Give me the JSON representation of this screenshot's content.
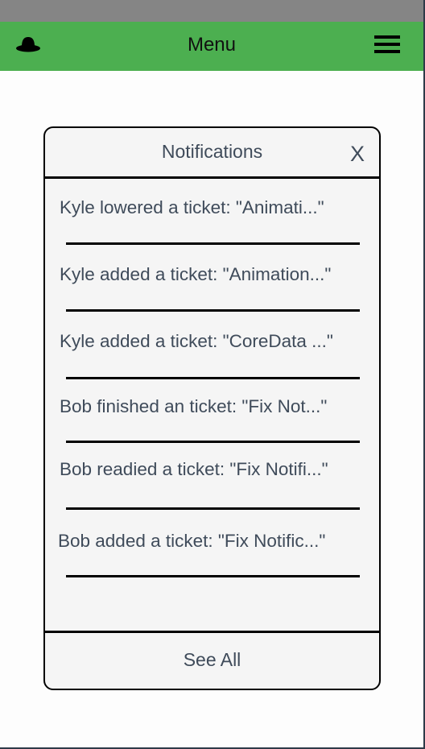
{
  "navbar": {
    "title": "Menu",
    "left_icon": "hat-icon",
    "right_icon": "hamburger-menu-icon",
    "color": "#4caf50"
  },
  "notifications": {
    "title": "Notifications",
    "close_label": "X",
    "items": [
      {
        "text": "Kyle lowered a ticket: \"Animati...\""
      },
      {
        "text": "Kyle added a ticket: \"Animation...\""
      },
      {
        "text": "Kyle added a ticket: \"CoreData ...\""
      },
      {
        "text": "Bob finished an ticket: \"Fix Not...\""
      },
      {
        "text": "Bob readied a ticket: \"Fix Notifi...\""
      },
      {
        "text": "Bob added a ticket: \"Fix Notific...\""
      }
    ],
    "see_all_label": "See All"
  }
}
